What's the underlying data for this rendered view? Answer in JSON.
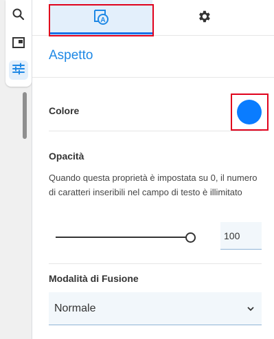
{
  "toolbar": {
    "items": [
      {
        "icon": "search-icon",
        "active": false
      },
      {
        "icon": "panel-layout-icon",
        "active": false
      },
      {
        "icon": "sliders-icon",
        "active": true
      }
    ]
  },
  "tabs": [
    {
      "icon": "text-color-format-icon",
      "active": true
    },
    {
      "icon": "gear-icon",
      "active": false
    }
  ],
  "section": {
    "title": "Aspetto"
  },
  "color": {
    "label": "Colore",
    "value": "#0a7cff"
  },
  "opacity": {
    "label": "Opacità",
    "description": "Quando questa proprietà è impostata su 0, il numero di caratteri inseribili nel campo di testo è illimitato",
    "value": "100"
  },
  "blend": {
    "label": "Modalità di Fusione",
    "value": "Normale"
  },
  "accent": "#1e88e5"
}
